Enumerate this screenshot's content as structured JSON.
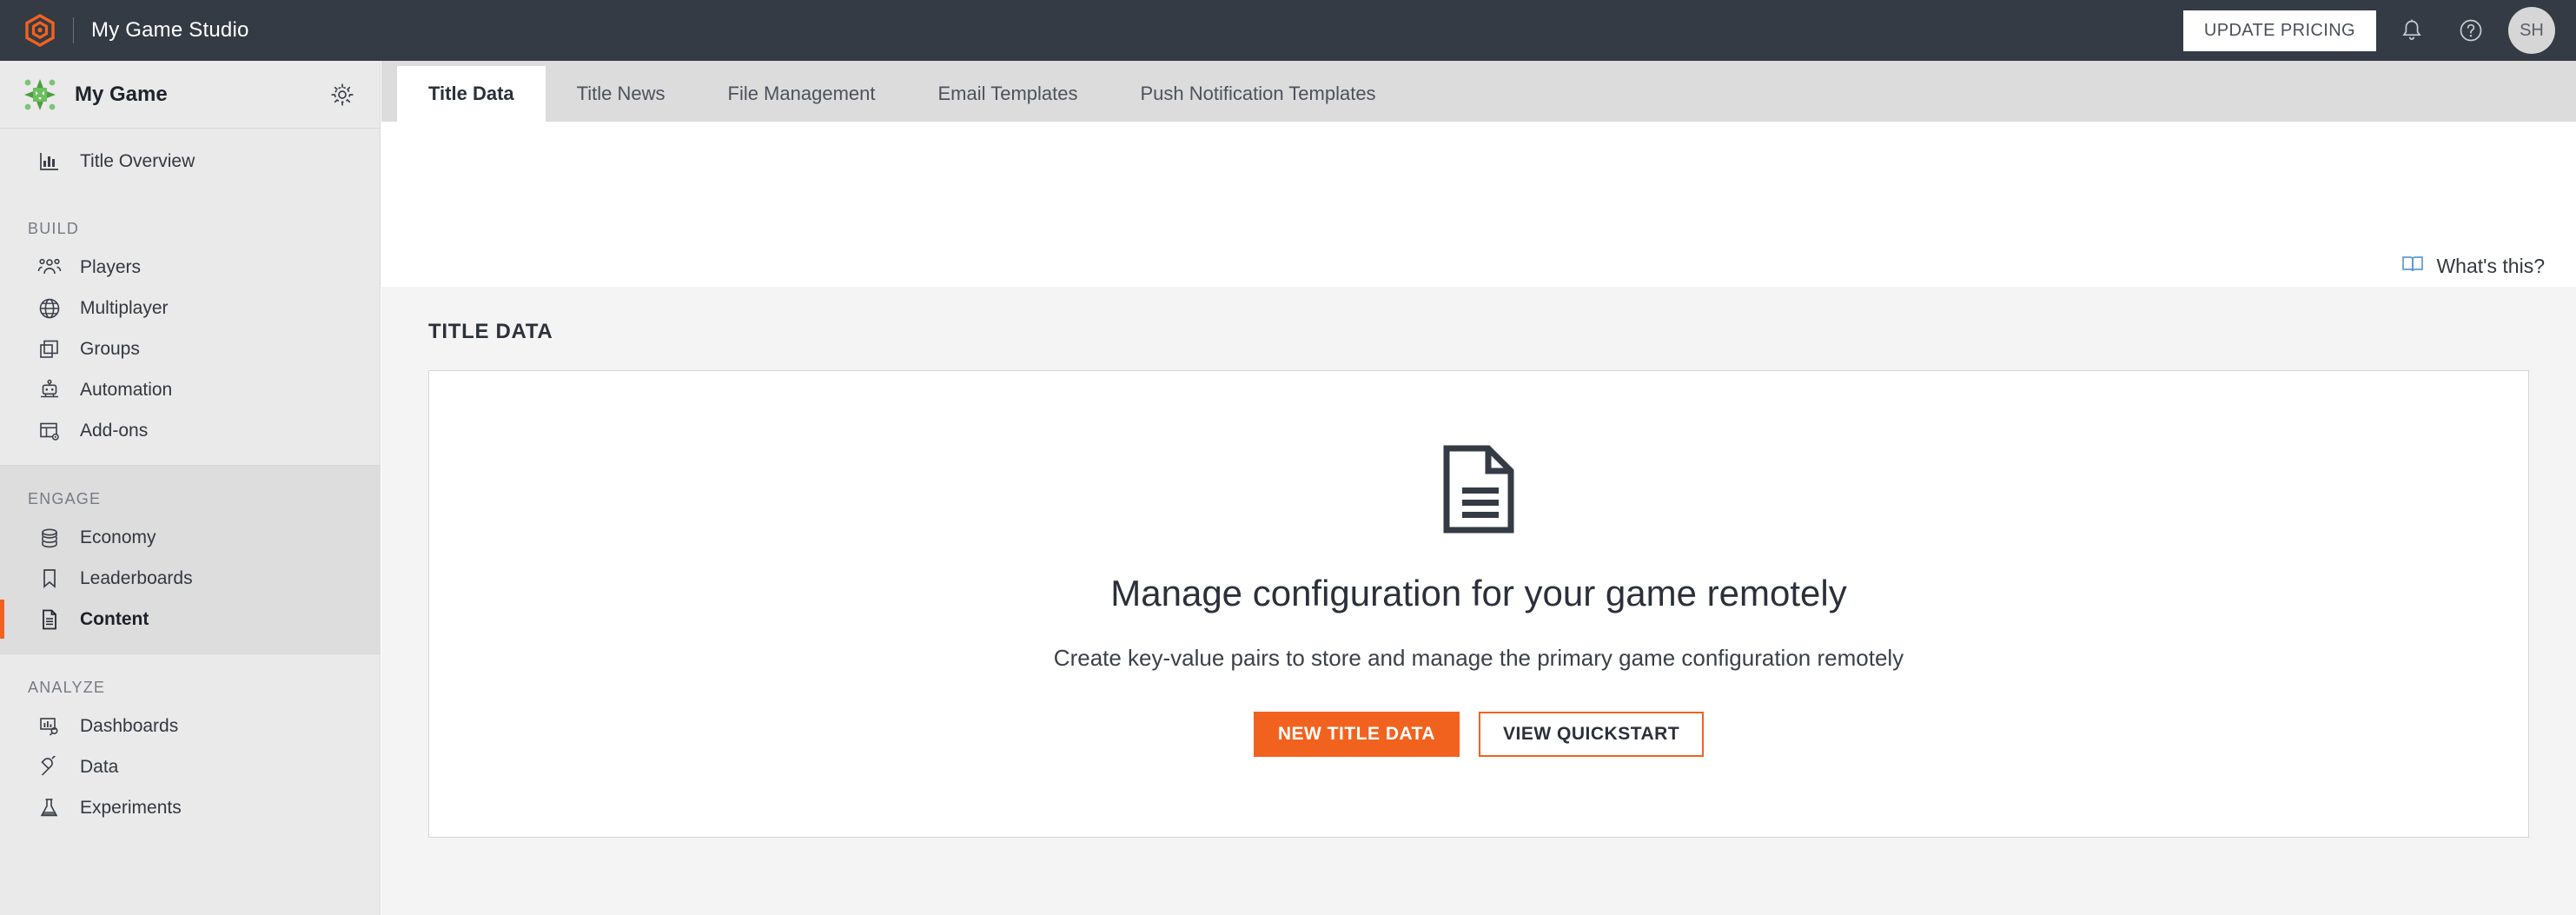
{
  "topbar": {
    "logo_icon": "playfab-hexagon-logo",
    "title": "My Game Studio",
    "update_pricing_label": "UPDATE PRICING",
    "notifications_icon": "bell-icon",
    "help_icon": "help-circle-icon",
    "avatar_initials": "SH",
    "background_color": "#343b45"
  },
  "sidebar": {
    "game_name": "My Game",
    "game_icon": "green-game-badge-icon",
    "settings_icon": "gear-icon",
    "overview": {
      "label": "Title Overview",
      "icon": "bar-chart-icon"
    },
    "groups": [
      {
        "label": "BUILD",
        "items": [
          {
            "label": "Players",
            "icon": "people-icon",
            "active": false
          },
          {
            "label": "Multiplayer",
            "icon": "globe-icon",
            "active": false
          },
          {
            "label": "Groups",
            "icon": "stacked-squares-icon",
            "active": false
          },
          {
            "label": "Automation",
            "icon": "robot-icon",
            "active": false
          },
          {
            "label": "Add-ons",
            "icon": "table-gear-icon",
            "active": false
          }
        ]
      },
      {
        "label": "ENGAGE",
        "items": [
          {
            "label": "Economy",
            "icon": "coins-stack-icon",
            "active": false
          },
          {
            "label": "Leaderboards",
            "icon": "bookmark-icon",
            "active": false
          },
          {
            "label": "Content",
            "icon": "document-icon",
            "active": true
          }
        ]
      },
      {
        "label": "ANALYZE",
        "items": [
          {
            "label": "Dashboards",
            "icon": "dashboard-search-icon",
            "active": false
          },
          {
            "label": "Data",
            "icon": "plug-icon",
            "active": false
          },
          {
            "label": "Experiments",
            "icon": "flask-icon",
            "active": false
          }
        ]
      }
    ],
    "active_accent_color": "#f2621f"
  },
  "main": {
    "tabs": [
      {
        "label": "Title Data",
        "active": true
      },
      {
        "label": "Title News",
        "active": false
      },
      {
        "label": "File Management",
        "active": false
      },
      {
        "label": "Email Templates",
        "active": false
      },
      {
        "label": "Push Notification Templates",
        "active": false
      }
    ],
    "whats_this": {
      "label": "What's this?",
      "icon": "book-icon",
      "icon_color": "#5b9bd5"
    },
    "section_title": "TITLE DATA",
    "empty_state": {
      "icon": "document-lines-icon",
      "heading": "Manage configuration for your game remotely",
      "description": "Create key-value pairs to store and manage the primary game configuration remotely",
      "primary_button": "NEW TITLE DATA",
      "secondary_button": "VIEW QUICKSTART",
      "primary_color": "#f2621f"
    }
  }
}
